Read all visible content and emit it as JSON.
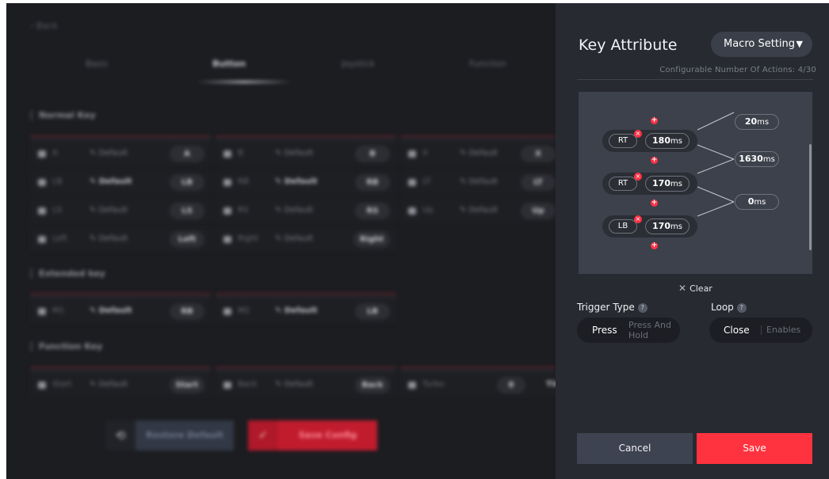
{
  "background": {
    "back_label": "Back",
    "tabs": [
      "Basic",
      "Button",
      "Joystick",
      "Function"
    ],
    "sections": {
      "normal": "Normal Key",
      "extended": "Extended key",
      "function": "Function Key"
    },
    "normal_keys": [
      {
        "name": "A",
        "edit": "Default",
        "value": "A"
      },
      {
        "name": "B",
        "edit": "Default",
        "value": "B"
      },
      {
        "name": "X",
        "edit": "Default",
        "value": "X"
      },
      {
        "name": "LB",
        "edit": "Default",
        "value": "LB"
      },
      {
        "name": "RB",
        "edit": "Default",
        "value": "RB"
      },
      {
        "name": "LT",
        "edit": "Default",
        "value": "LT"
      },
      {
        "name": "LS",
        "edit": "Default",
        "value": "LS"
      },
      {
        "name": "RS",
        "edit": "Default",
        "value": "RS"
      },
      {
        "name": "Up",
        "edit": "Default",
        "value": "Up"
      },
      {
        "name": "Left",
        "edit": "Default",
        "value": "Left"
      },
      {
        "name": "Right",
        "edit": "Default",
        "value": "Right"
      }
    ],
    "extended_keys": [
      {
        "name": "M1",
        "edit": "Default",
        "value": "RB"
      },
      {
        "name": "M2",
        "edit": "Default",
        "value": "LB"
      }
    ],
    "function_keys": [
      {
        "name": "Start",
        "edit": "Default",
        "value": "Start"
      },
      {
        "name": "Back",
        "edit": "Default",
        "value": "Back"
      },
      {
        "name": "Turbo",
        "edit": "Default",
        "value": "8",
        "extra": "Time"
      }
    ],
    "restore_label": "Restore Default",
    "save_config_label": "Save Config"
  },
  "panel": {
    "title": "Key Attribute",
    "mode_select": "Macro Setting",
    "config_count": "Configurable Number Of Actions: 4/30",
    "actions": [
      {
        "key": "RT",
        "duration": "180",
        "unit": "ms"
      },
      {
        "key": "RT",
        "duration": "170",
        "unit": "ms"
      },
      {
        "key": "LB",
        "duration": "170",
        "unit": "ms"
      }
    ],
    "delays": [
      {
        "value": "20",
        "unit": "ms"
      },
      {
        "value": "1630",
        "unit": "ms"
      },
      {
        "value": "0",
        "unit": "ms"
      }
    ],
    "clear_label": "Clear",
    "trigger_type": {
      "label": "Trigger Type",
      "options": [
        "Press",
        "Press And Hold"
      ],
      "selected": "Press"
    },
    "loop": {
      "label": "Loop",
      "options": [
        "Close",
        "Enables"
      ],
      "selected": "Close"
    },
    "cancel_label": "Cancel",
    "save_label": "Save"
  },
  "colors": {
    "accent_red": "#ff333f",
    "panel_bg": "#272a31",
    "macro_bg": "#3c414b"
  },
  "icons": [
    "restore-icon",
    "check-icon",
    "remove-icon",
    "add-icon",
    "close-icon",
    "help-icon",
    "caret-down-icon",
    "edit-icon"
  ]
}
